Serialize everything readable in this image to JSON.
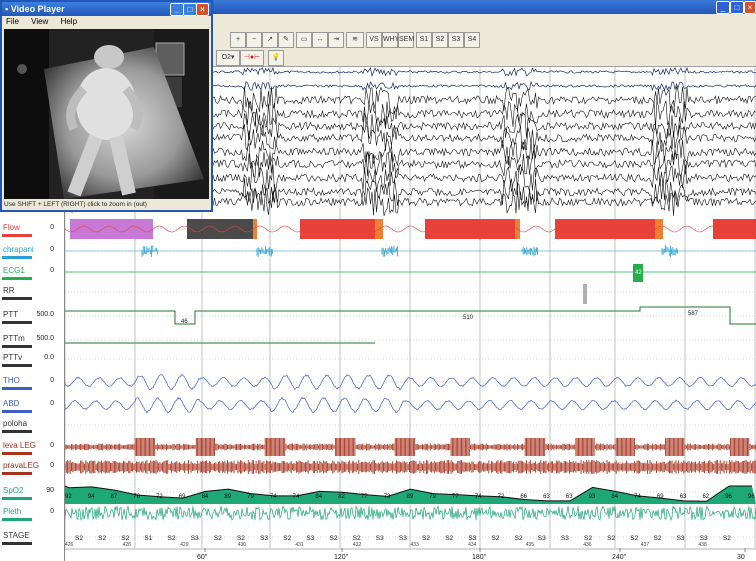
{
  "video_player": {
    "title": "Video Player",
    "menu": [
      "File",
      "View",
      "Help"
    ],
    "status": "Use SHIFT + LEFT (RIGHT) click to zoom in (out)"
  },
  "toolbar": {
    "buttons_row1": [
      "VS",
      "WHY",
      "SEM",
      "S1",
      "S2",
      "S3",
      "S4"
    ],
    "o2_label": "O2"
  },
  "channels": [
    {
      "label": "Flow",
      "value": "0",
      "color": "#e8413a"
    },
    {
      "label": "chrapani",
      "value": "0",
      "color": "#2a9fd6"
    },
    {
      "label": "ECG1",
      "value": "0",
      "color": "#23b04a"
    },
    {
      "label": "RR",
      "value": "",
      "color": "#333333"
    },
    {
      "label": "PTT",
      "value": "500.0",
      "color": "#333333"
    },
    {
      "label": "PTTm",
      "value": "500.0",
      "color": "#333333"
    },
    {
      "label": "PTTv",
      "value": "0.0",
      "color": "#333333"
    },
    {
      "label": "THO",
      "value": "0",
      "color": "#3a5fc8"
    },
    {
      "label": "ABD",
      "value": "0",
      "color": "#3a5fc8"
    },
    {
      "label": "poloha",
      "value": "",
      "color": "#333333"
    },
    {
      "label": "leva LEG",
      "value": "0",
      "color": "#a8331f"
    },
    {
      "label": "pravaLEG",
      "value": "0",
      "color": "#a8331f"
    },
    {
      "label": "SpO2",
      "value": "90",
      "color": "#1ea877"
    },
    {
      "label": "Pleth",
      "value": "0",
      "color": "#1ea877"
    },
    {
      "label": "STAGE",
      "value": "",
      "color": "#333333"
    }
  ],
  "ptt_labels": [
    "46",
    "510",
    "587"
  ],
  "ecg_marker": "42",
  "spo2_values": [
    "92",
    "94",
    "87",
    "76",
    "72",
    "69",
    "84",
    "89",
    "79",
    "74",
    "74",
    "84",
    "82",
    "77",
    "73",
    "89",
    "79",
    "77",
    "74",
    "72",
    "66",
    "63",
    "63",
    "93",
    "84",
    "74",
    "69",
    "63",
    "62",
    "96",
    "96"
  ],
  "stage_labels": [
    "S2",
    "S2",
    "S2",
    "S1",
    "S2",
    "S3",
    "S2",
    "S2",
    "S3",
    "S2",
    "S3",
    "S2",
    "S2",
    "S3",
    "S3",
    "S2",
    "S2",
    "S3",
    "S2",
    "S2",
    "S3",
    "S3",
    "S2",
    "S2",
    "S2",
    "S2",
    "S3",
    "S3",
    "S2"
  ],
  "stage_numbers": [
    "426",
    "428",
    "429",
    "430",
    "431",
    "432",
    "433",
    "434",
    "435",
    "436",
    "437",
    "438"
  ],
  "time_ticks": [
    "60\"",
    "120\"",
    "180\"",
    "240\"",
    "30"
  ]
}
